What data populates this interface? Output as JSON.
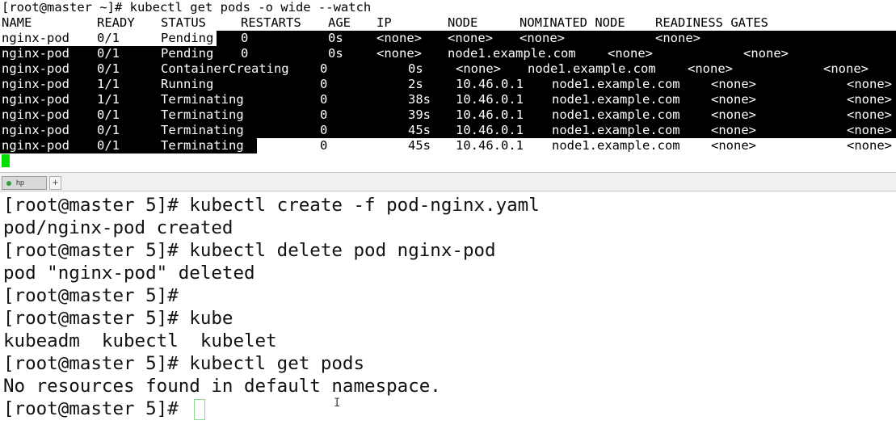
{
  "top_terminal": {
    "command_line": "[root@master ~]# kubectl get pods -o wide --watch",
    "header": [
      "NAME",
      "READY",
      "STATUS",
      "RESTARTS",
      "AGE",
      "IP",
      "NODE",
      "NOMINATED NODE",
      "READINESS GATES"
    ],
    "rows": [
      [
        "nginx-pod",
        "0/1",
        "Pending",
        "0",
        "0s",
        "<none>",
        "<none>",
        "<none>",
        "<none>"
      ],
      [
        "nginx-pod",
        "0/1",
        "Pending",
        "0",
        "0s",
        "<none>",
        "node1.example.com",
        "<none>",
        "<none>"
      ],
      [
        "nginx-pod",
        "0/1",
        "ContainerCreating",
        "0",
        "0s",
        "<none>",
        "node1.example.com",
        "<none>",
        "<none>"
      ],
      [
        "nginx-pod",
        "1/1",
        "Running",
        "0",
        "2s",
        "10.46.0.1",
        "node1.example.com",
        "<none>",
        "<none>"
      ],
      [
        "nginx-pod",
        "1/1",
        "Terminating",
        "0",
        "38s",
        "10.46.0.1",
        "node1.example.com",
        "<none>",
        "<none>"
      ],
      [
        "nginx-pod",
        "0/1",
        "Terminating",
        "0",
        "39s",
        "10.46.0.1",
        "node1.example.com",
        "<none>",
        "<none>"
      ],
      [
        "nginx-pod",
        "0/1",
        "Terminating",
        "0",
        "45s",
        "10.46.0.1",
        "node1.example.com",
        "<none>",
        "<none>"
      ],
      [
        "nginx-pod",
        "0/1",
        "Terminating",
        "0",
        "45s",
        "10.46.0.1",
        "node1.example.com",
        "<none>",
        "<none>"
      ]
    ],
    "cursor_color": "#00e000"
  },
  "tabbar": {
    "active_tab": "hp",
    "add_tab_label": "+"
  },
  "bottom_terminal": {
    "lines": [
      "[root@master 5]# kubectl create -f pod-nginx.yaml",
      "pod/nginx-pod created",
      "[root@master 5]# kubectl delete pod nginx-pod",
      "pod \"nginx-pod\" deleted",
      "[root@master 5]#",
      "[root@master 5]# kube",
      "kubeadm  kubectl  kubelet",
      "[root@master 5]# kubectl get pods",
      "No resources found in default namespace.",
      "[root@master 5]# "
    ]
  },
  "colors": {
    "selection_bg": "#000000",
    "selection_fg": "#ffffff",
    "text": "#111111",
    "tab_status": "#2ea043"
  }
}
